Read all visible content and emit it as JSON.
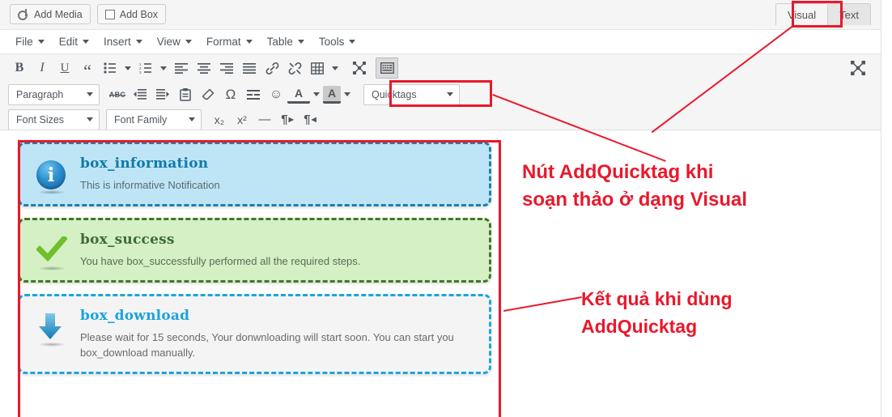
{
  "media_bar": {
    "add_media_label": "Add Media",
    "add_box_label": "Add Box"
  },
  "tabs": {
    "visual_label": "Visual",
    "text_label": "Text",
    "active": "Visual"
  },
  "menubar": {
    "items": [
      {
        "label": "File"
      },
      {
        "label": "Edit"
      },
      {
        "label": "Insert"
      },
      {
        "label": "View"
      },
      {
        "label": "Format"
      },
      {
        "label": "Table"
      },
      {
        "label": "Tools"
      }
    ]
  },
  "toolbar_row1": {
    "bold": "B",
    "italic": "I",
    "underline": "U",
    "blockquote": "“",
    "bullet_list": "bullet-list-icon",
    "numbered_list": "numbered-list-icon",
    "align_left": "align-left-icon",
    "align_center": "align-center-icon",
    "align_right": "align-right-icon",
    "align_justify": "align-justify-icon",
    "link": "link-icon",
    "unlink": "unlink-icon",
    "table": "table-icon",
    "fullscreen": "fullscreen-icon",
    "toolbar_toggle": "toolbar-toggle-icon",
    "distraction_free": "distraction-free-icon"
  },
  "toolbar_row2": {
    "paragraph_label": "Paragraph",
    "strikethrough": "ABC",
    "outdent": "outdent-icon",
    "indent": "indent-icon",
    "paste_text": "paste-icon",
    "clear_formatting": "eraser-icon",
    "special_character": "Ω",
    "horizontal_rule": "horizontal-rule-icon",
    "emoticon": "☺",
    "text_color": "A",
    "background_color": "A",
    "quicktags_label": "Quicktags"
  },
  "toolbar_row3": {
    "font_sizes_label": "Font Sizes",
    "font_family_label": "Font Family",
    "subscript": "x₂",
    "superscript": "x²",
    "horizontal_line": "—",
    "ltr": "¶",
    "rtl": "¶"
  },
  "content": {
    "boxes": [
      {
        "id": "box_information",
        "icon": "info-circle-icon",
        "title": "box_information",
        "body": "This is informative Notification",
        "bg_color": "#bde5f5",
        "border_color": "#1f7fa8",
        "title_color": "#1279a8"
      },
      {
        "id": "box_success",
        "icon": "check-mark-icon",
        "title": "box_success",
        "body": "You have box_successfully performed all the required steps.",
        "bg_color": "#d4f0c4",
        "border_color": "#41762c",
        "title_color": "#3f6b36"
      },
      {
        "id": "box_download",
        "icon": "download-arrow-icon",
        "title": "box_download",
        "body": "Please wait for 15 seconds, Your donwnloading will start soon. You can start you box_download manually.",
        "bg_color": "#f4f4f4",
        "border_color": "#19a6e0",
        "title_color": "#1aa3dd"
      }
    ]
  },
  "annotations": {
    "accent_color": "#e8192c",
    "note_quicktags_line1": "Nút AddQuicktag khi",
    "note_quicktags_line2": "soạn thảo ở dạng Visual",
    "note_result_line1": "Kết quả khi dùng",
    "note_result_line2": "AddQuicktag"
  }
}
